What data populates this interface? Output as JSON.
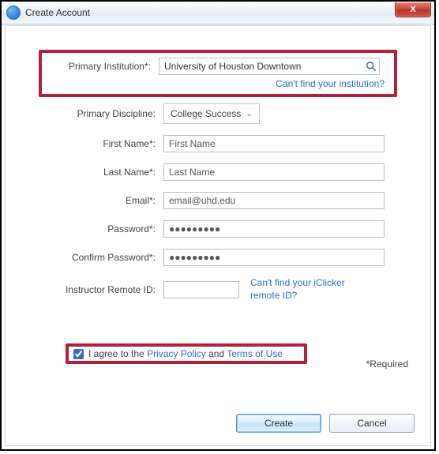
{
  "window": {
    "title": "Create Account",
    "close_glyph": "X"
  },
  "labels": {
    "primary_institution": "Primary Institution*:",
    "primary_discipline": "Primary Discipline:",
    "first_name": "First Name*:",
    "last_name": "Last Name*:",
    "email": "Email*:",
    "password": "Password*:",
    "confirm_password": "Confirm Password*:",
    "instructor_remote_id": "Instructor Remote ID:"
  },
  "values": {
    "primary_institution": "University of Houston Downtown",
    "primary_discipline": "College Success",
    "first_name": "First Name",
    "last_name": "Last Name",
    "email": "email@uhd.edu",
    "password": "●●●●●●●●●",
    "confirm_password": "●●●●●●●●●",
    "instructor_remote_id": ""
  },
  "links": {
    "cant_find_institution": "Can't find your institution?",
    "cant_find_remote": "Can't find your iClicker remote ID?",
    "privacy_policy": "Privacy Policy",
    "terms_of_use": "Terms of Use"
  },
  "agree": {
    "prefix": "I agree to the ",
    "and": " and "
  },
  "required_note": "*Required",
  "buttons": {
    "create": "Create",
    "cancel": "Cancel"
  }
}
